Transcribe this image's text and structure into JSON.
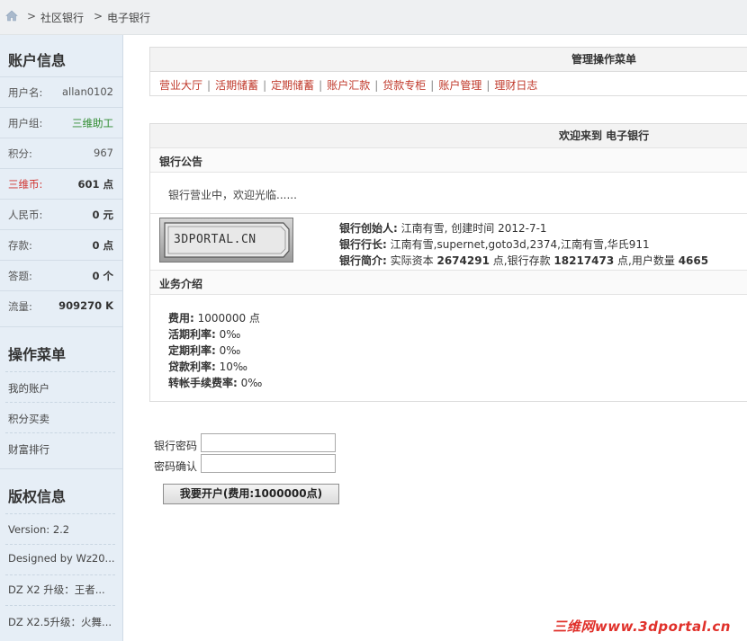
{
  "breadcrumb": {
    "items": [
      "社区银行",
      "电子银行"
    ],
    "separator": ">"
  },
  "sidebar": {
    "account_title": "账户信息",
    "account_rows": [
      {
        "label": "用户名:",
        "value": "allan0102"
      },
      {
        "label": "用户组:",
        "value": "三维助工"
      },
      {
        "label": "积分:",
        "value": "967"
      },
      {
        "label": "三维币:",
        "value": "601 点"
      },
      {
        "label": "人民币:",
        "value": "0 元"
      },
      {
        "label": "存款:",
        "value": "0 点"
      },
      {
        "label": "答题:",
        "value": "0 个"
      },
      {
        "label": "流量:",
        "value": "909270 K"
      }
    ],
    "menu_title": "操作菜单",
    "menu_items": [
      "我的账户",
      "积分买卖",
      "财富排行"
    ],
    "copyright_title": "版权信息",
    "copyright_items": [
      "Version: 2.2",
      "Designed by Wz20...",
      "DZ X2 升级：王者...",
      "DZ X2.5升级：火舞..."
    ]
  },
  "menu_panel": {
    "title": "管理操作菜单",
    "links": [
      "营业大厅",
      "活期储蓄",
      "定期储蓄",
      "账户汇款",
      "贷款专柜",
      "账户管理",
      "理财日志"
    ]
  },
  "welcome_panel": {
    "title": "欢迎来到 电子银行",
    "notice_title": "银行公告",
    "notice_text": "银行营业中，欢迎光临......",
    "logo_text": "3DPORTAL.CN",
    "founder_label": "银行创始人:",
    "founder_value": "江南有雪, 创建时间 2012-7-1",
    "president_label": "银行行长:",
    "president_value": "江南有雪,supernet,goto3d,2374,江南有雪,华氏911",
    "intro_label": "银行简介:",
    "intro_pre": "实际资本",
    "intro_capital": "2674291",
    "intro_mid": "点,银行存款",
    "intro_deposit": "18217473",
    "intro_mid2": "点,用户数量",
    "intro_users": "4665",
    "business_title": "业务介绍",
    "business": [
      {
        "label": "费用:",
        "value": "1000000 点"
      },
      {
        "label": "活期利率:",
        "value": "0‰"
      },
      {
        "label": "定期利率:",
        "value": "0‰"
      },
      {
        "label": "贷款利率:",
        "value": "10‰"
      },
      {
        "label": "转帐手续费率:",
        "value": "0‰"
      }
    ]
  },
  "form": {
    "password_label": "银行密码",
    "password_value": "",
    "confirm_label": "密码确认",
    "confirm_value": "",
    "submit_label": "我要开户(费用:1000000点)"
  },
  "watermark": "三维网www.3dportal.cn",
  "colors": {
    "link_red": "#c0392b",
    "group_green": "#2e8b2e",
    "coin_red": "#d0312d",
    "sidebar_bg": "#e6eef6"
  }
}
